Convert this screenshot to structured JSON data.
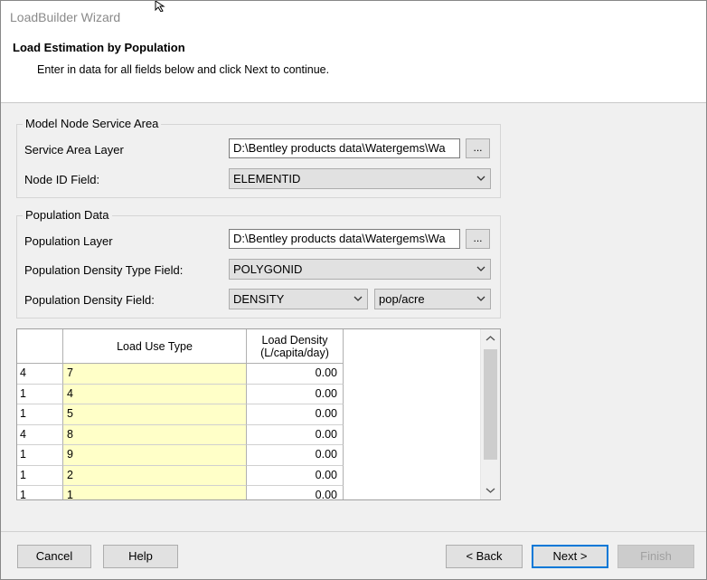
{
  "window": {
    "title": "LoadBuilder Wizard"
  },
  "header": {
    "title": "Load Estimation by Population",
    "subtitle": "Enter in data for all fields below and click  Next to continue."
  },
  "service_area": {
    "legend": "Model Node Service Area",
    "layer_label": "Service Area Layer",
    "layer_value": "D:\\Bentley products data\\Watergems\\Wa",
    "browse_label": "...",
    "node_id_label": "Node ID Field:",
    "node_id_value": "ELEMENTID"
  },
  "population": {
    "legend": "Population Data",
    "layer_label": "Population Layer",
    "layer_value": "D:\\Bentley products data\\Watergems\\Wa",
    "browse_label": "...",
    "density_type_label": "Population Density Type Field:",
    "density_type_value": "POLYGONID",
    "density_label": "Population Density Field:",
    "density_value": "DENSITY",
    "density_unit": "pop/acre"
  },
  "grid": {
    "columns": {
      "load_use_type": "Load Use Type",
      "load_density_1": "Load Density",
      "load_density_2": "(L/capita/day)"
    },
    "rows": [
      {
        "id": "4",
        "type": "7",
        "density": "0.00"
      },
      {
        "id": "1",
        "type": "4",
        "density": "0.00"
      },
      {
        "id": "1",
        "type": "5",
        "density": "0.00"
      },
      {
        "id": "4",
        "type": "8",
        "density": "0.00"
      },
      {
        "id": "1",
        "type": "9",
        "density": "0.00"
      },
      {
        "id": "1",
        "type": "2",
        "density": "0.00"
      },
      {
        "id": "1",
        "type": "1",
        "density": "0.00"
      }
    ]
  },
  "buttons": {
    "cancel": "Cancel",
    "help": "Help",
    "back": "< Back",
    "next": "Next >",
    "finish": "Finish"
  },
  "icons": {
    "browse": "ellipsis-icon",
    "dropdown": "chevron-down-icon",
    "scroll_up": "chevron-up-icon",
    "scroll_down": "chevron-down-icon",
    "cursor": "mouse-cursor-icon"
  },
  "colors": {
    "editable_cell": "#ffffc8",
    "default_button_border": "#0078d7",
    "title_text": "#8a8a8a"
  }
}
